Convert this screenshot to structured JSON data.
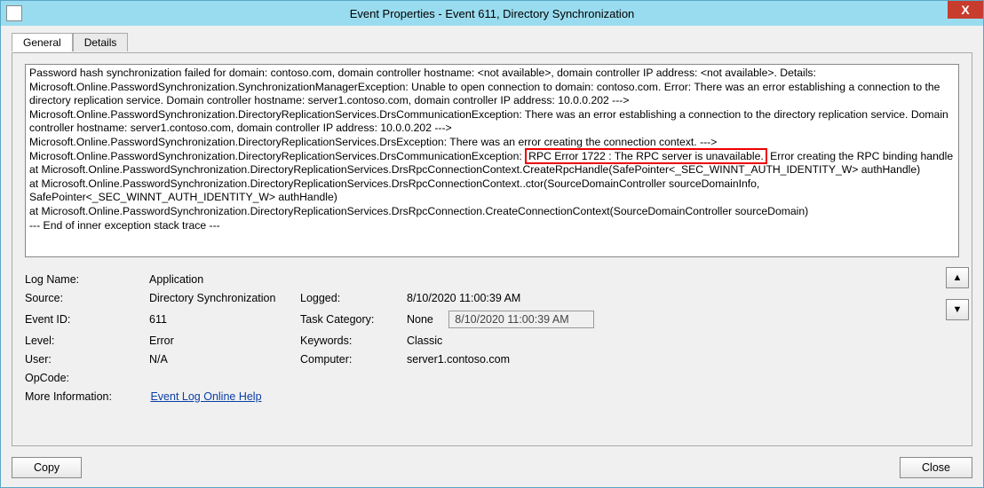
{
  "window": {
    "title": "Event Properties - Event 611, Directory Synchronization",
    "close_glyph": "X"
  },
  "tabs": {
    "general": "General",
    "details": "Details"
  },
  "description": {
    "line1_a": "Password hash synchronization failed for domain: ",
    "domain": "contoso.com",
    "line1_b": ", domain controller hostname: <not available>, domain controller IP address: <not available>. Details:",
    "line2": "Microsoft.Online.PasswordSynchronization.SynchronizationManagerException: Unable to open connection to domain: contoso.com. Error: There was an error establishing a connection to the directory replication service. Domain controller hostname:  server1.contoso.com,  domain controller IP address: 10.0.0.202 --->",
    "line3": "Microsoft.Online.PasswordSynchronization.DirectoryReplicationServices.DrsCommunicationException: There was an error establishing a connection to the directory replication service. Domain controller hostname:  server1.contoso.com,   domain controller IP address: 10.0.0.202 --->",
    "line4": "Microsoft.Online.PasswordSynchronization.DirectoryReplicationServices.DrsException: There was an error creating the connection context. --->",
    "line5_a": "Microsoft.Online.PasswordSynchronization.DirectoryReplicationServices.DrsCommunicationException: ",
    "highlight": "RPC Error 1722 : The RPC server is unavailable.",
    "line5_b": " Error creating the RPC binding handle",
    "line6": "   at Microsoft.Online.PasswordSynchronization.DirectoryReplicationServices.DrsRpcConnectionContext.CreateRpcHandle(SafePointer<_SEC_WINNT_AUTH_IDENTITY_W> authHandle)",
    "line7": "   at Microsoft.Online.PasswordSynchronization.DirectoryReplicationServices.DrsRpcConnectionContext..ctor(SourceDomainController sourceDomainInfo, SafePointer<_SEC_WINNT_AUTH_IDENTITY_W> authHandle)",
    "line8": "   at Microsoft.Online.PasswordSynchronization.DirectoryReplicationServices.DrsRpcConnection.CreateConnectionContext(SourceDomainController sourceDomain)",
    "line9": "   --- End of inner exception stack trace ---"
  },
  "fields": {
    "log_name_label": "Log Name:",
    "log_name_value": "Application",
    "source_label": "Source:",
    "source_value": "Directory Synchronization",
    "logged_label": "Logged:",
    "logged_value": "8/10/2020 11:00:39 AM",
    "event_id_label": "Event ID:",
    "event_id_value": "611",
    "task_category_label": "Task Category:",
    "task_category_value": "None",
    "timebox_value": "8/10/2020 11:00:39 AM",
    "level_label": "Level:",
    "level_value": "Error",
    "keywords_label": "Keywords:",
    "keywords_value": "Classic",
    "user_label": "User:",
    "user_value": "N/A",
    "computer_label": "Computer:",
    "computer_value": "server1.contoso.com",
    "opcode_label": "OpCode:",
    "more_info_label": "More Information:",
    "more_info_link": "Event Log Online Help"
  },
  "buttons": {
    "copy": "Copy",
    "close": "Close",
    "up_glyph": "▲",
    "down_glyph": "▼"
  }
}
